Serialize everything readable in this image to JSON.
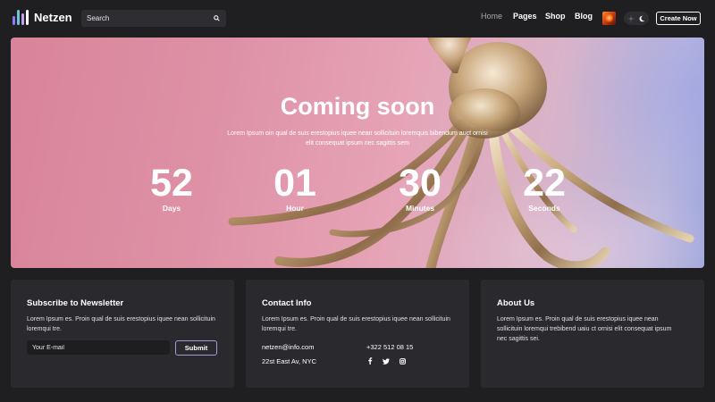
{
  "brand": {
    "name": "Netzen",
    "logo_colors": [
      "#8a7cf0",
      "#6ec7d9",
      "#c4a2f2",
      "#ffffff"
    ]
  },
  "search": {
    "placeholder": "Search",
    "icon": "search-icon"
  },
  "nav": {
    "items": [
      {
        "label": "Home",
        "active": false
      },
      {
        "label": "Pages",
        "active": true
      },
      {
        "label": "Shop",
        "active": true
      },
      {
        "label": "Blog",
        "active": true
      }
    ],
    "create_label": "Create Now",
    "theme_icons": [
      "sun-icon",
      "moon-icon"
    ]
  },
  "hero": {
    "title": "Coming soon",
    "subtitle": "Lorem Ipsum oin qual de suis erestopius iquee nean sollicituin loremquis bibendum auct ornisi elit consequat ipsum nec sagittis sem",
    "countdown": [
      {
        "value": "52",
        "label": "Days"
      },
      {
        "value": "01",
        "label": "Hour"
      },
      {
        "value": "30",
        "label": "Minutes"
      },
      {
        "value": "22",
        "label": "Seconds"
      }
    ]
  },
  "newsletter": {
    "title": "Subscribe to Newsletter",
    "text": "Lorem Ipsum es. Proin qual de suis erestopius iquee nean sollicituin loremqui tre.",
    "placeholder": "Your E-mail",
    "button": "Submit"
  },
  "contact": {
    "title": "Contact Info",
    "text": "Lorem Ipsum es. Proin qual de suis erestopius iquee nean sollicituin loremqui tre.",
    "email": "netzen@info.com",
    "phone": "+322 512 08 15",
    "address": "22st East Av, NYC",
    "social_icons": [
      "facebook-icon",
      "twitter-icon",
      "instagram-icon"
    ]
  },
  "about": {
    "title": "About Us",
    "text": "Lorem Ipsum es. Proin qual de suis erestopius iquee nean sollicituin loremqui trebibend uaiu ct ornisi elit consequat ipsum nec sagittis sei."
  },
  "colors": {
    "background": "#1f1f22",
    "card": "#2a2a2e",
    "accent_border": "#a79ad8"
  }
}
